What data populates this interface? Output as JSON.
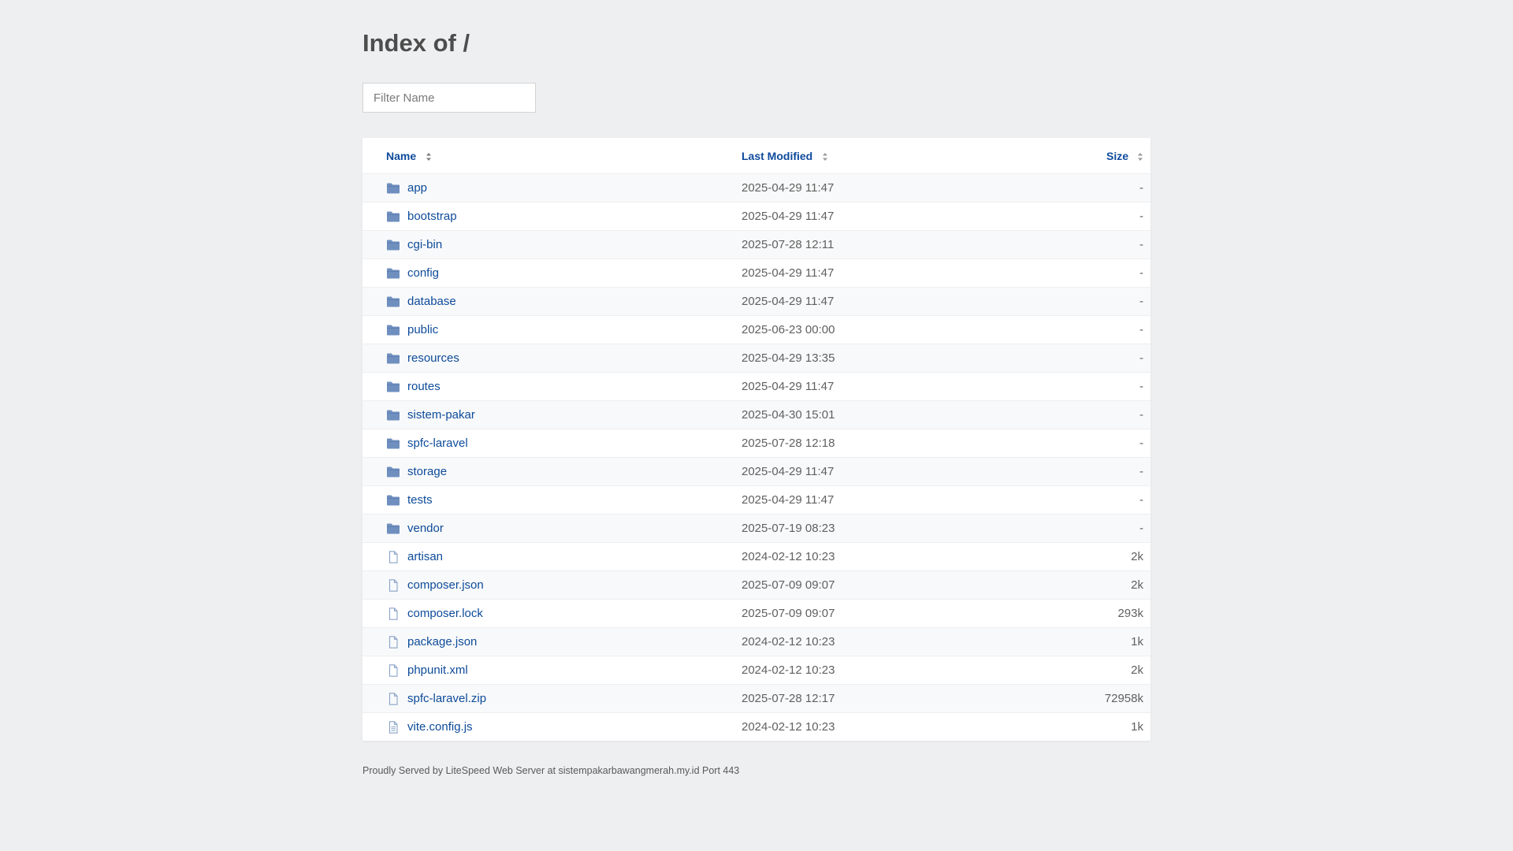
{
  "page": {
    "title": "Index of /",
    "filter_placeholder": "Filter Name",
    "footer": "Proudly Served by LiteSpeed Web Server at sistempakarbawangmerah.my.id Port 443"
  },
  "table": {
    "headers": {
      "name": "Name",
      "modified": "Last Modified",
      "size": "Size"
    },
    "rows": [
      {
        "name": "app",
        "modified": "2025-04-29 11:47",
        "size": "-",
        "type": "folder"
      },
      {
        "name": "bootstrap",
        "modified": "2025-04-29 11:47",
        "size": "-",
        "type": "folder"
      },
      {
        "name": "cgi-bin",
        "modified": "2025-07-28 12:11",
        "size": "-",
        "type": "folder"
      },
      {
        "name": "config",
        "modified": "2025-04-29 11:47",
        "size": "-",
        "type": "folder"
      },
      {
        "name": "database",
        "modified": "2025-04-29 11:47",
        "size": "-",
        "type": "folder"
      },
      {
        "name": "public",
        "modified": "2025-06-23 00:00",
        "size": "-",
        "type": "folder"
      },
      {
        "name": "resources",
        "modified": "2025-04-29 13:35",
        "size": "-",
        "type": "folder"
      },
      {
        "name": "routes",
        "modified": "2025-04-29 11:47",
        "size": "-",
        "type": "folder"
      },
      {
        "name": "sistem-pakar",
        "modified": "2025-04-30 15:01",
        "size": "-",
        "type": "folder"
      },
      {
        "name": "spfc-laravel",
        "modified": "2025-07-28 12:18",
        "size": "-",
        "type": "folder"
      },
      {
        "name": "storage",
        "modified": "2025-04-29 11:47",
        "size": "-",
        "type": "folder"
      },
      {
        "name": "tests",
        "modified": "2025-04-29 11:47",
        "size": "-",
        "type": "folder"
      },
      {
        "name": "vendor",
        "modified": "2025-07-19 08:23",
        "size": "-",
        "type": "folder"
      },
      {
        "name": "artisan",
        "modified": "2024-02-12 10:23",
        "size": "2k",
        "type": "file"
      },
      {
        "name": "composer.json",
        "modified": "2025-07-09 09:07",
        "size": "2k",
        "type": "file"
      },
      {
        "name": "composer.lock",
        "modified": "2025-07-09 09:07",
        "size": "293k",
        "type": "file"
      },
      {
        "name": "package.json",
        "modified": "2024-02-12 10:23",
        "size": "1k",
        "type": "file"
      },
      {
        "name": "phpunit.xml",
        "modified": "2024-02-12 10:23",
        "size": "2k",
        "type": "file"
      },
      {
        "name": "spfc-laravel.zip",
        "modified": "2025-07-28 12:17",
        "size": "72958k",
        "type": "file"
      },
      {
        "name": "vite.config.js",
        "modified": "2024-02-12 10:23",
        "size": "1k",
        "type": "text-file"
      }
    ]
  },
  "colors": {
    "background": "#eeeff1",
    "link": "#0d4b9a",
    "folder_icon": "#6f8fbf",
    "file_icon": "#8aa3c8"
  }
}
